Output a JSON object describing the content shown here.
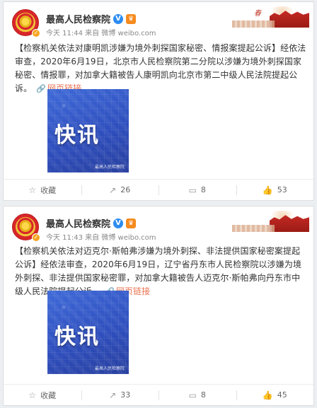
{
  "posts": [
    {
      "account": {
        "name": "最高人民检察院",
        "verified_icon": "V",
        "badge_icon": "crown-icon"
      },
      "time": "今天 11:44 来自 微博 weibo.com",
      "text": "【检察机关依法对康明凯涉嫌为境外刺探国家秘密、情报案提起公诉】经依法审查，2020年6月19日，北京市人民检察院第二分院以涉嫌为境外刺探国家秘密、情报罪，对加拿大籍被告人康明凯向北京市第二中级人民法院提起公诉。",
      "link_icon": "link-icon",
      "link_text": "网页链接",
      "image": {
        "headline": "快讯",
        "watermark": "最高人民检察院"
      },
      "actions": {
        "collect": "收藏",
        "forward": "26",
        "comment": "8",
        "like": "53"
      }
    },
    {
      "account": {
        "name": "最高人民检察院",
        "verified_icon": "V",
        "badge_icon": "crown-icon"
      },
      "time": "今天 11:43 来自 微博 weibo.com",
      "text": "【检察机关依法对迈克尔·斯帕弗涉嫌为境外刺探、非法提供国家秘密案提起公诉】经依法审查，2020年6月19日，辽宁省丹东市人民检察院以涉嫌为境外刺探、非法提供国家秘密罪，对加拿大籍被告人迈克尔·斯帕弗向丹东市中级人民法院提起公诉。",
      "link_icon": "link-icon",
      "link_text": "网页链接",
      "image": {
        "headline": "快讯",
        "watermark": "最高人民检察院"
      },
      "actions": {
        "collect": "收藏",
        "forward": "33",
        "comment": "8",
        "like": "45"
      }
    }
  ],
  "banner": {
    "slogan": "春"
  }
}
